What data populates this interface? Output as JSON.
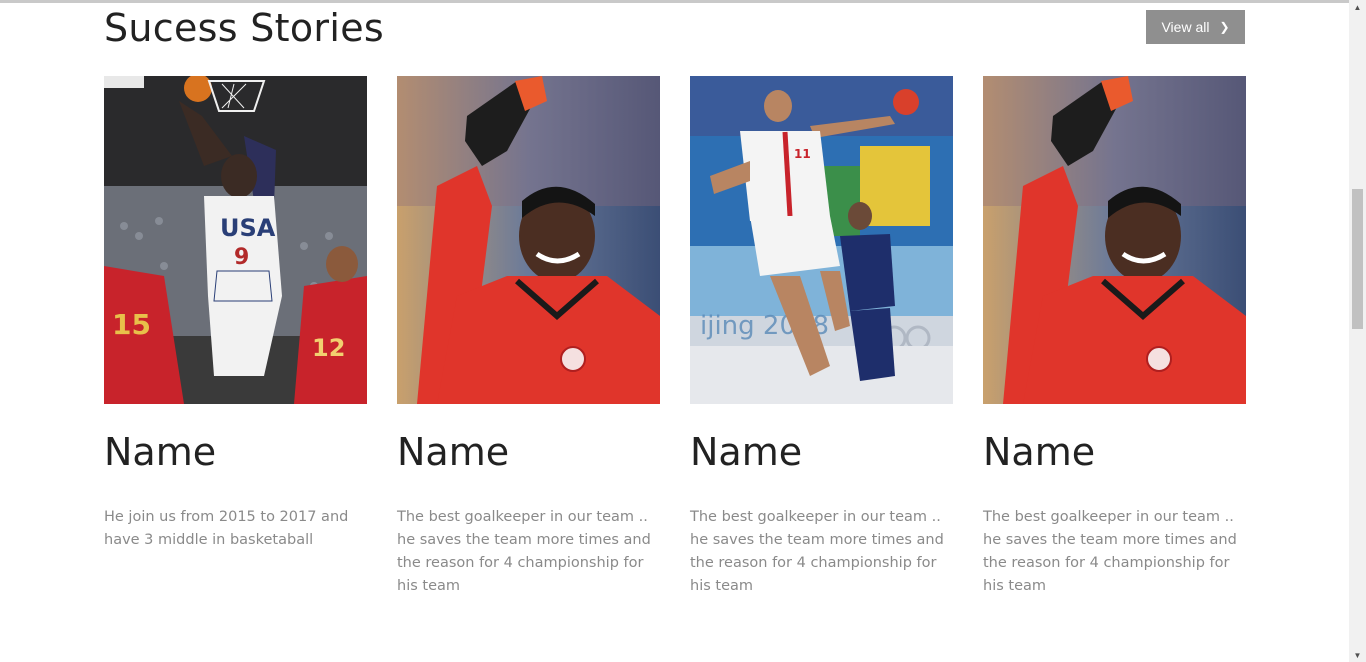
{
  "section": {
    "title": "Sucess Stories",
    "view_all_label": "View all"
  },
  "cards": [
    {
      "name": "Name",
      "description": "He join us from 2015 to 2017 and have 3 middle in basketaball",
      "image": "basketball-player-photo"
    },
    {
      "name": "Name",
      "description": "The best goalkeeper in our team .. he saves the team more times and the reason for 4 championship for his team",
      "image": "goalkeeper-photo"
    },
    {
      "name": "Name",
      "description": "The best goalkeeper in our team .. he saves the team more times and the reason for 4 championship for his team",
      "image": "handball-player-photo"
    },
    {
      "name": "Name",
      "description": "The best goalkeeper in our team .. he saves the team more times and the reason for 4 championship for his team",
      "image": "goalkeeper-photo"
    }
  ],
  "colors": {
    "button_bg": "#8f8f8f",
    "title_text": "#222222",
    "body_text": "#8a8a8a"
  },
  "photo_text": {
    "jersey_team": "USA",
    "jersey_number": "9",
    "opponent_number_left": "15",
    "opponent_number_right": "12",
    "handball_number": "11",
    "banner_text": "ijing 2008"
  }
}
